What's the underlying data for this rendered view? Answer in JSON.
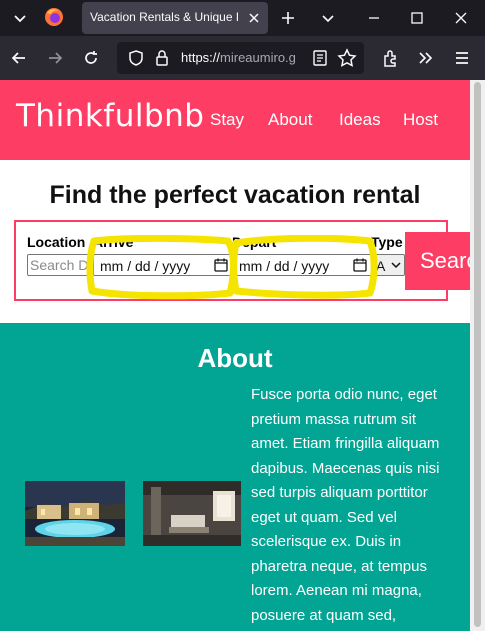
{
  "browser": {
    "tab_title": "Vacation Rentals & Unique Homes",
    "url_prefix": "https://",
    "url_host": "mireaumiro.g",
    "icons": [
      "chevron-down-icon",
      "firefox-logo-icon",
      "close-icon",
      "plus-icon",
      "chevron-down-icon",
      "minimize-icon",
      "maximize-icon",
      "close-icon",
      "back-arrow-icon",
      "forward-arrow-icon",
      "reload-icon",
      "shield-icon",
      "lock-icon",
      "reader-view-icon",
      "bookmark-star-icon",
      "extensions-icon",
      "overflow-icon",
      "menu-icon"
    ]
  },
  "site": {
    "logo": "Thinkfulbnb",
    "nav": [
      "Stay",
      "About",
      "Ideas",
      "Host"
    ],
    "brand_color": "#fd3d63",
    "accent_color": "#02a494"
  },
  "search": {
    "title": "Find the perfect vacation rental",
    "location_label": "Location",
    "location_placeholder": "Search Destination",
    "arrive_label": "Arrive",
    "arrive_value": "mm / dd / yyyy",
    "depart_label": "Depart",
    "depart_value": "mm / dd / yyyy",
    "type_label": "Type",
    "type_value": "A",
    "button_label": "Search"
  },
  "about": {
    "title": "About",
    "body": "Fusce porta odio nunc, eget pretium massa rutrum sit amet. Etiam fringilla aliquam dapibus. Maecenas quis nisi sed turpis aliquam porttitor eget ut quam. Sed vel scelerisque ex. Duis in pharetra neque, at tempus lorem. Aenean mi magna, posuere at quam sed,"
  },
  "annotation": {
    "highlight_color": "#f5e400"
  }
}
